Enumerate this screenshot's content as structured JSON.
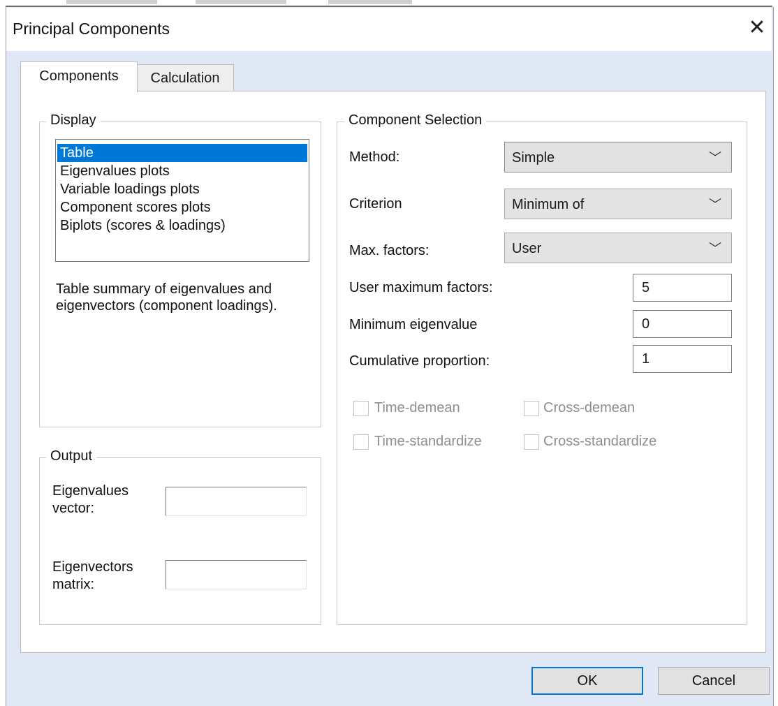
{
  "window": {
    "title": "Principal Components"
  },
  "tabs": [
    {
      "label": "Components",
      "active": true
    },
    {
      "label": "Calculation",
      "active": false
    }
  ],
  "display": {
    "label": "Display",
    "items": [
      "Table",
      "Eigenvalues plots",
      "Variable loadings plots",
      "Component scores plots",
      "Biplots (scores & loadings)"
    ],
    "selected": "Table",
    "description": "Table summary of eigenvalues and eigenvectors (component loadings)."
  },
  "output": {
    "label": "Output",
    "eigenvalues_label_1": "Eigenvalues",
    "eigenvalues_label_2": "vector:",
    "eigenvalues_value": "",
    "eigenvectors_label_1": "Eigenvectors",
    "eigenvectors_label_2": "matrix:",
    "eigenvectors_value": ""
  },
  "selection": {
    "label": "Component Selection",
    "method_label": "Method:",
    "method_value": "Simple",
    "criterion_label": "Criterion",
    "criterion_value": "Minimum of",
    "max_factors_label": "Max. factors:",
    "max_factors_value": "User",
    "user_max_label": "User maximum factors:",
    "user_max_value": "5",
    "min_eigen_label": "Minimum eigenvalue",
    "min_eigen_value": "0",
    "cum_prop_label": "Cumulative proportion:",
    "cum_prop_value": "1"
  },
  "checkboxes": {
    "time_demean": "Time-demean",
    "cross_demean": "Cross-demean",
    "time_standardize": "Time-standardize",
    "cross_standardize": "Cross-standardize",
    "enabled": false,
    "checked": false
  },
  "buttons": {
    "ok": "OK",
    "cancel": "Cancel"
  },
  "icons": {
    "close": "close-icon",
    "dropdown": "chevron-down-icon"
  },
  "colors": {
    "selection": "#0078d7",
    "dialog_bg": "#dfe8f4",
    "disabled_text": "#8e8e8e"
  }
}
